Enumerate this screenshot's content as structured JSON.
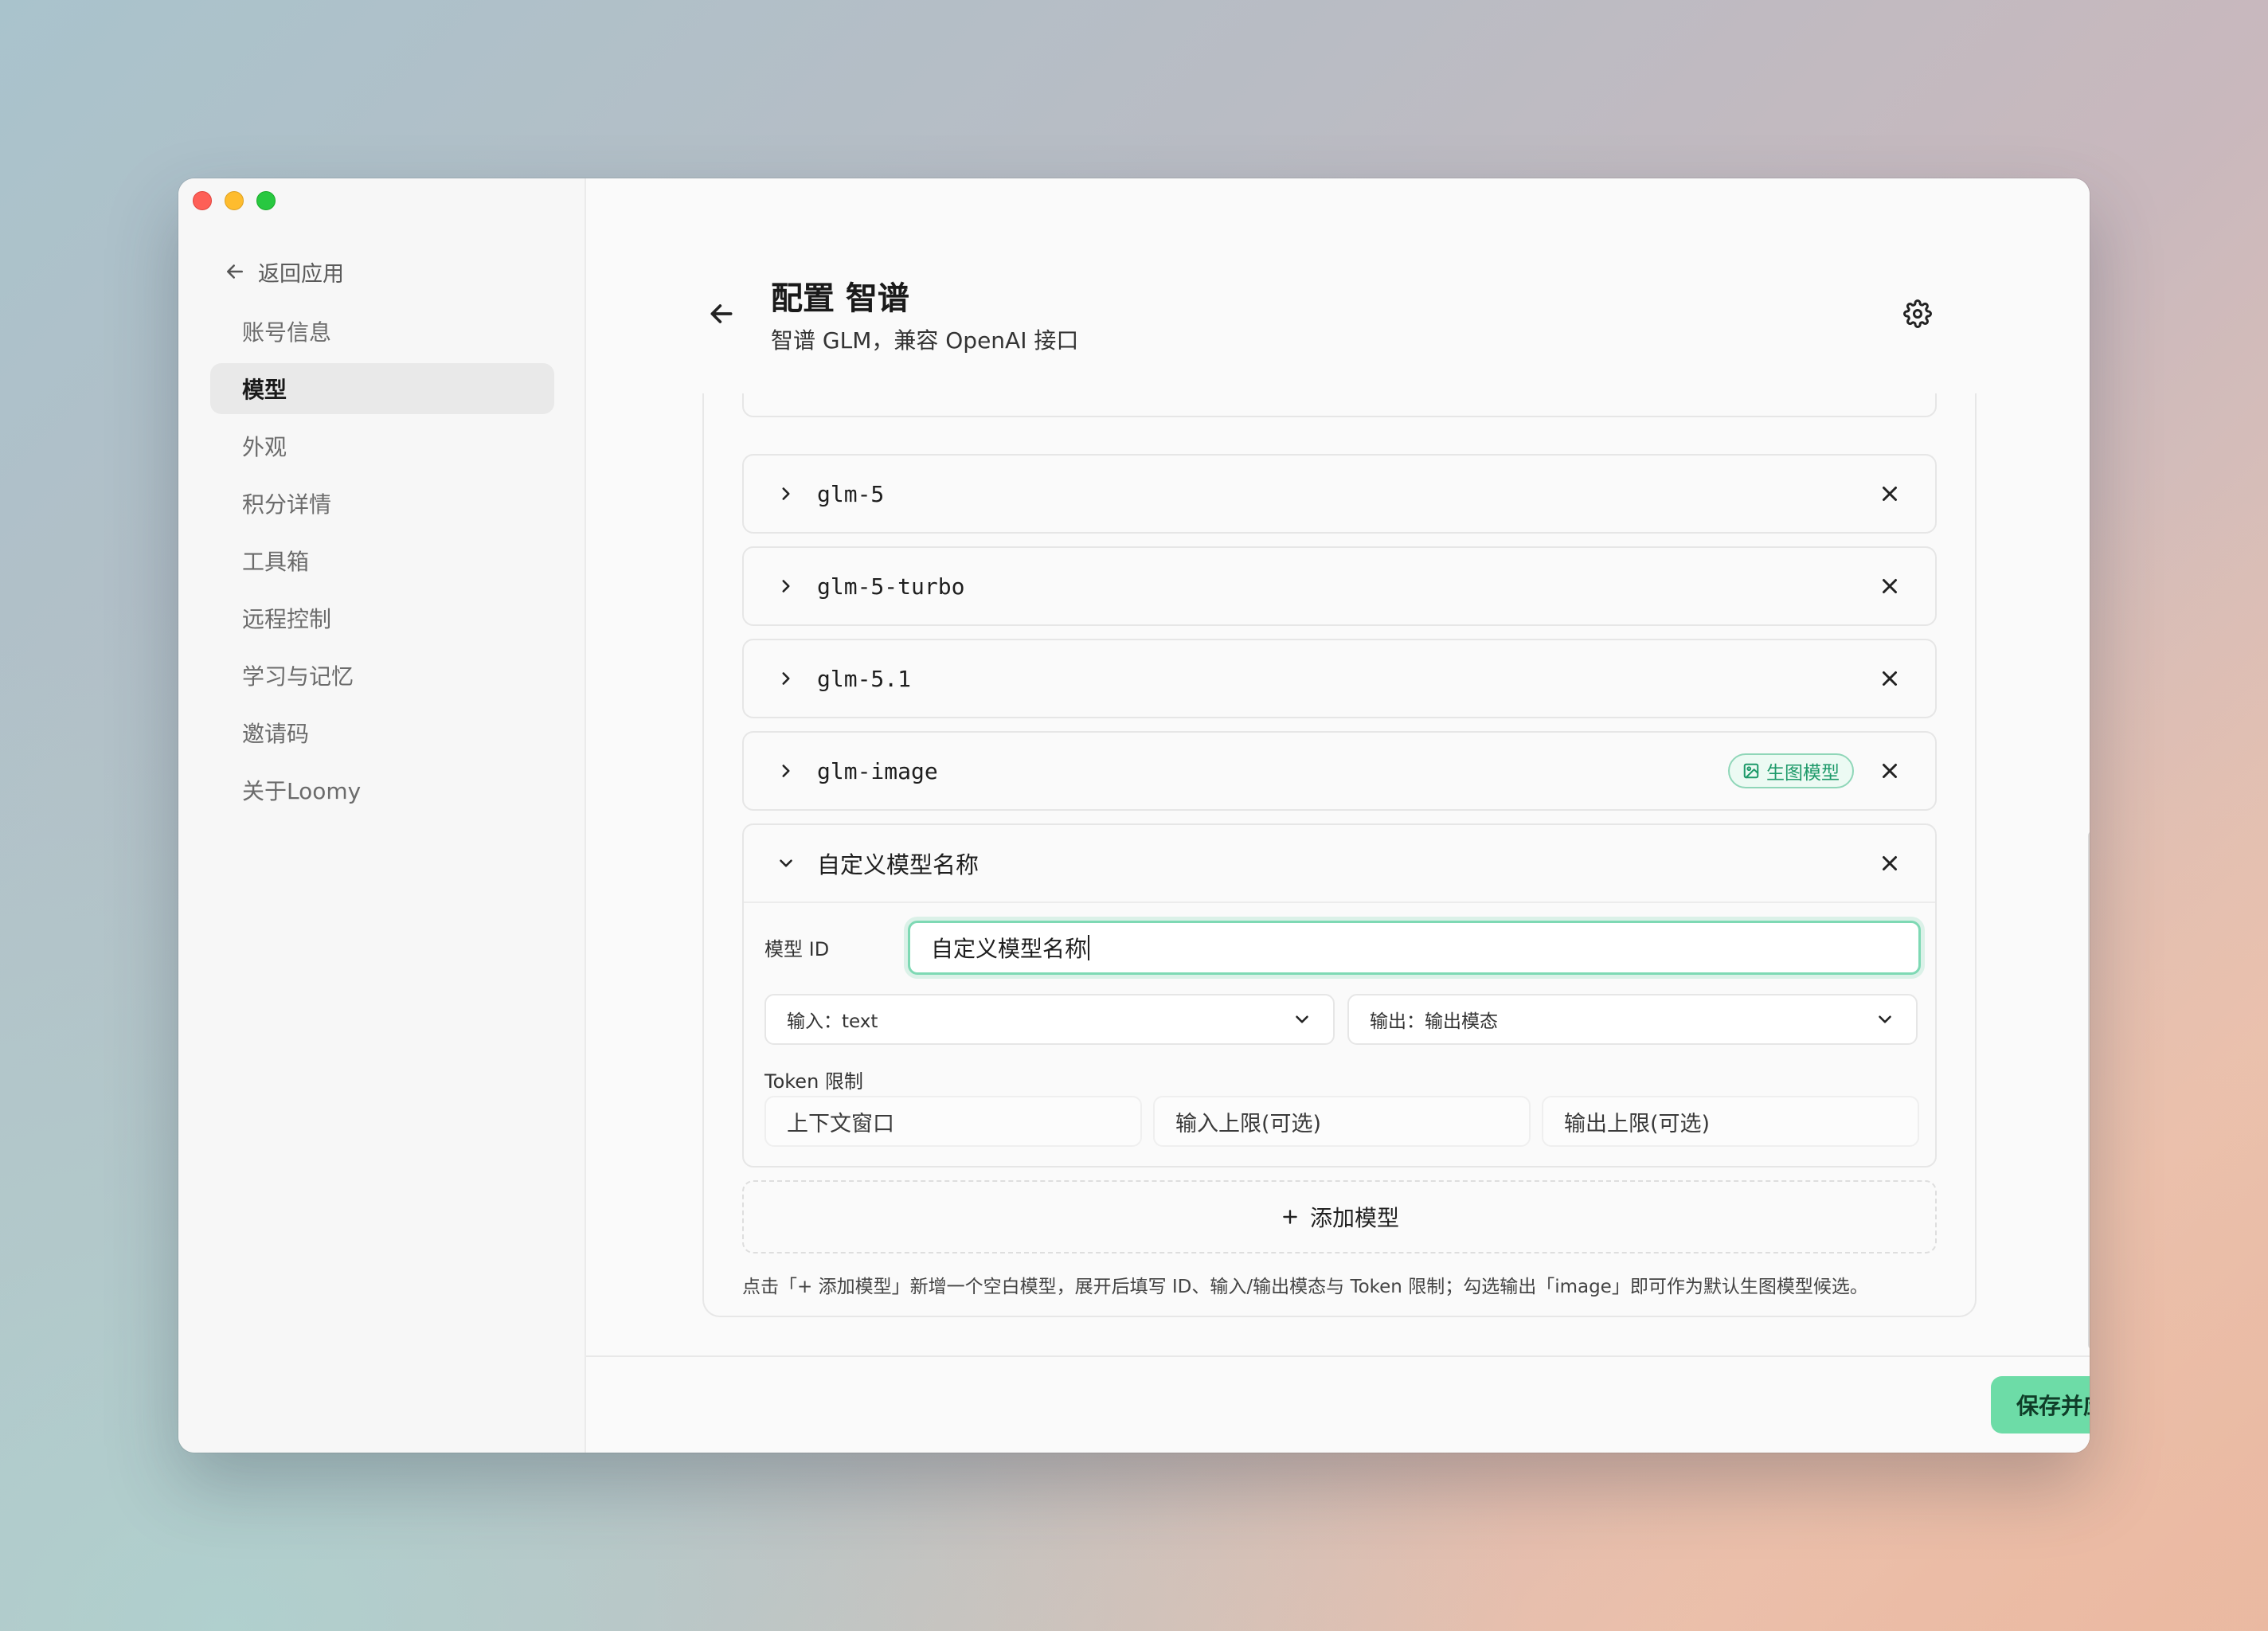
{
  "sidebar": {
    "back_label": "返回应用",
    "items": [
      {
        "label": "账号信息",
        "active": false
      },
      {
        "label": "模型",
        "active": true
      },
      {
        "label": "外观",
        "active": false
      },
      {
        "label": "积分详情",
        "active": false
      },
      {
        "label": "工具箱",
        "active": false
      },
      {
        "label": "远程控制",
        "active": false
      },
      {
        "label": "学习与记忆",
        "active": false
      },
      {
        "label": "邀请码",
        "active": false
      },
      {
        "label": "关于Loomy",
        "active": false
      }
    ]
  },
  "header": {
    "title": "配置 智谱",
    "subtitle": "智谱 GLM，兼容 OpenAI 接口"
  },
  "models": [
    {
      "name": "glm-5"
    },
    {
      "name": "glm-5-turbo"
    },
    {
      "name": "glm-5.1"
    },
    {
      "name": "glm-image",
      "badge": "生图模型"
    }
  ],
  "expanded_model": {
    "name": "自定义模型名称",
    "id_label": "模型 ID",
    "id_value": "自定义模型名称",
    "input_select": "输入：text",
    "output_select": "输出：输出模态",
    "token_label": "Token 限制",
    "token_fields": {
      "context_placeholder": "上下文窗口",
      "input_limit_placeholder": "输入上限(可选)",
      "output_limit_placeholder": "输出上限(可选)"
    }
  },
  "add_model_label": "添加模型",
  "hint": "点击「+ 添加模型」新增一个空白模型，展开后填写 ID、输入/输出模态与 Token 限制；勾选输出「image」即可作为默认生图模型候选。",
  "footer": {
    "save_label": "保存并应用"
  },
  "colors": {
    "accent": "#6ddca7",
    "badge_text": "#1e9a6a",
    "focus_border": "#7ed9b4"
  }
}
